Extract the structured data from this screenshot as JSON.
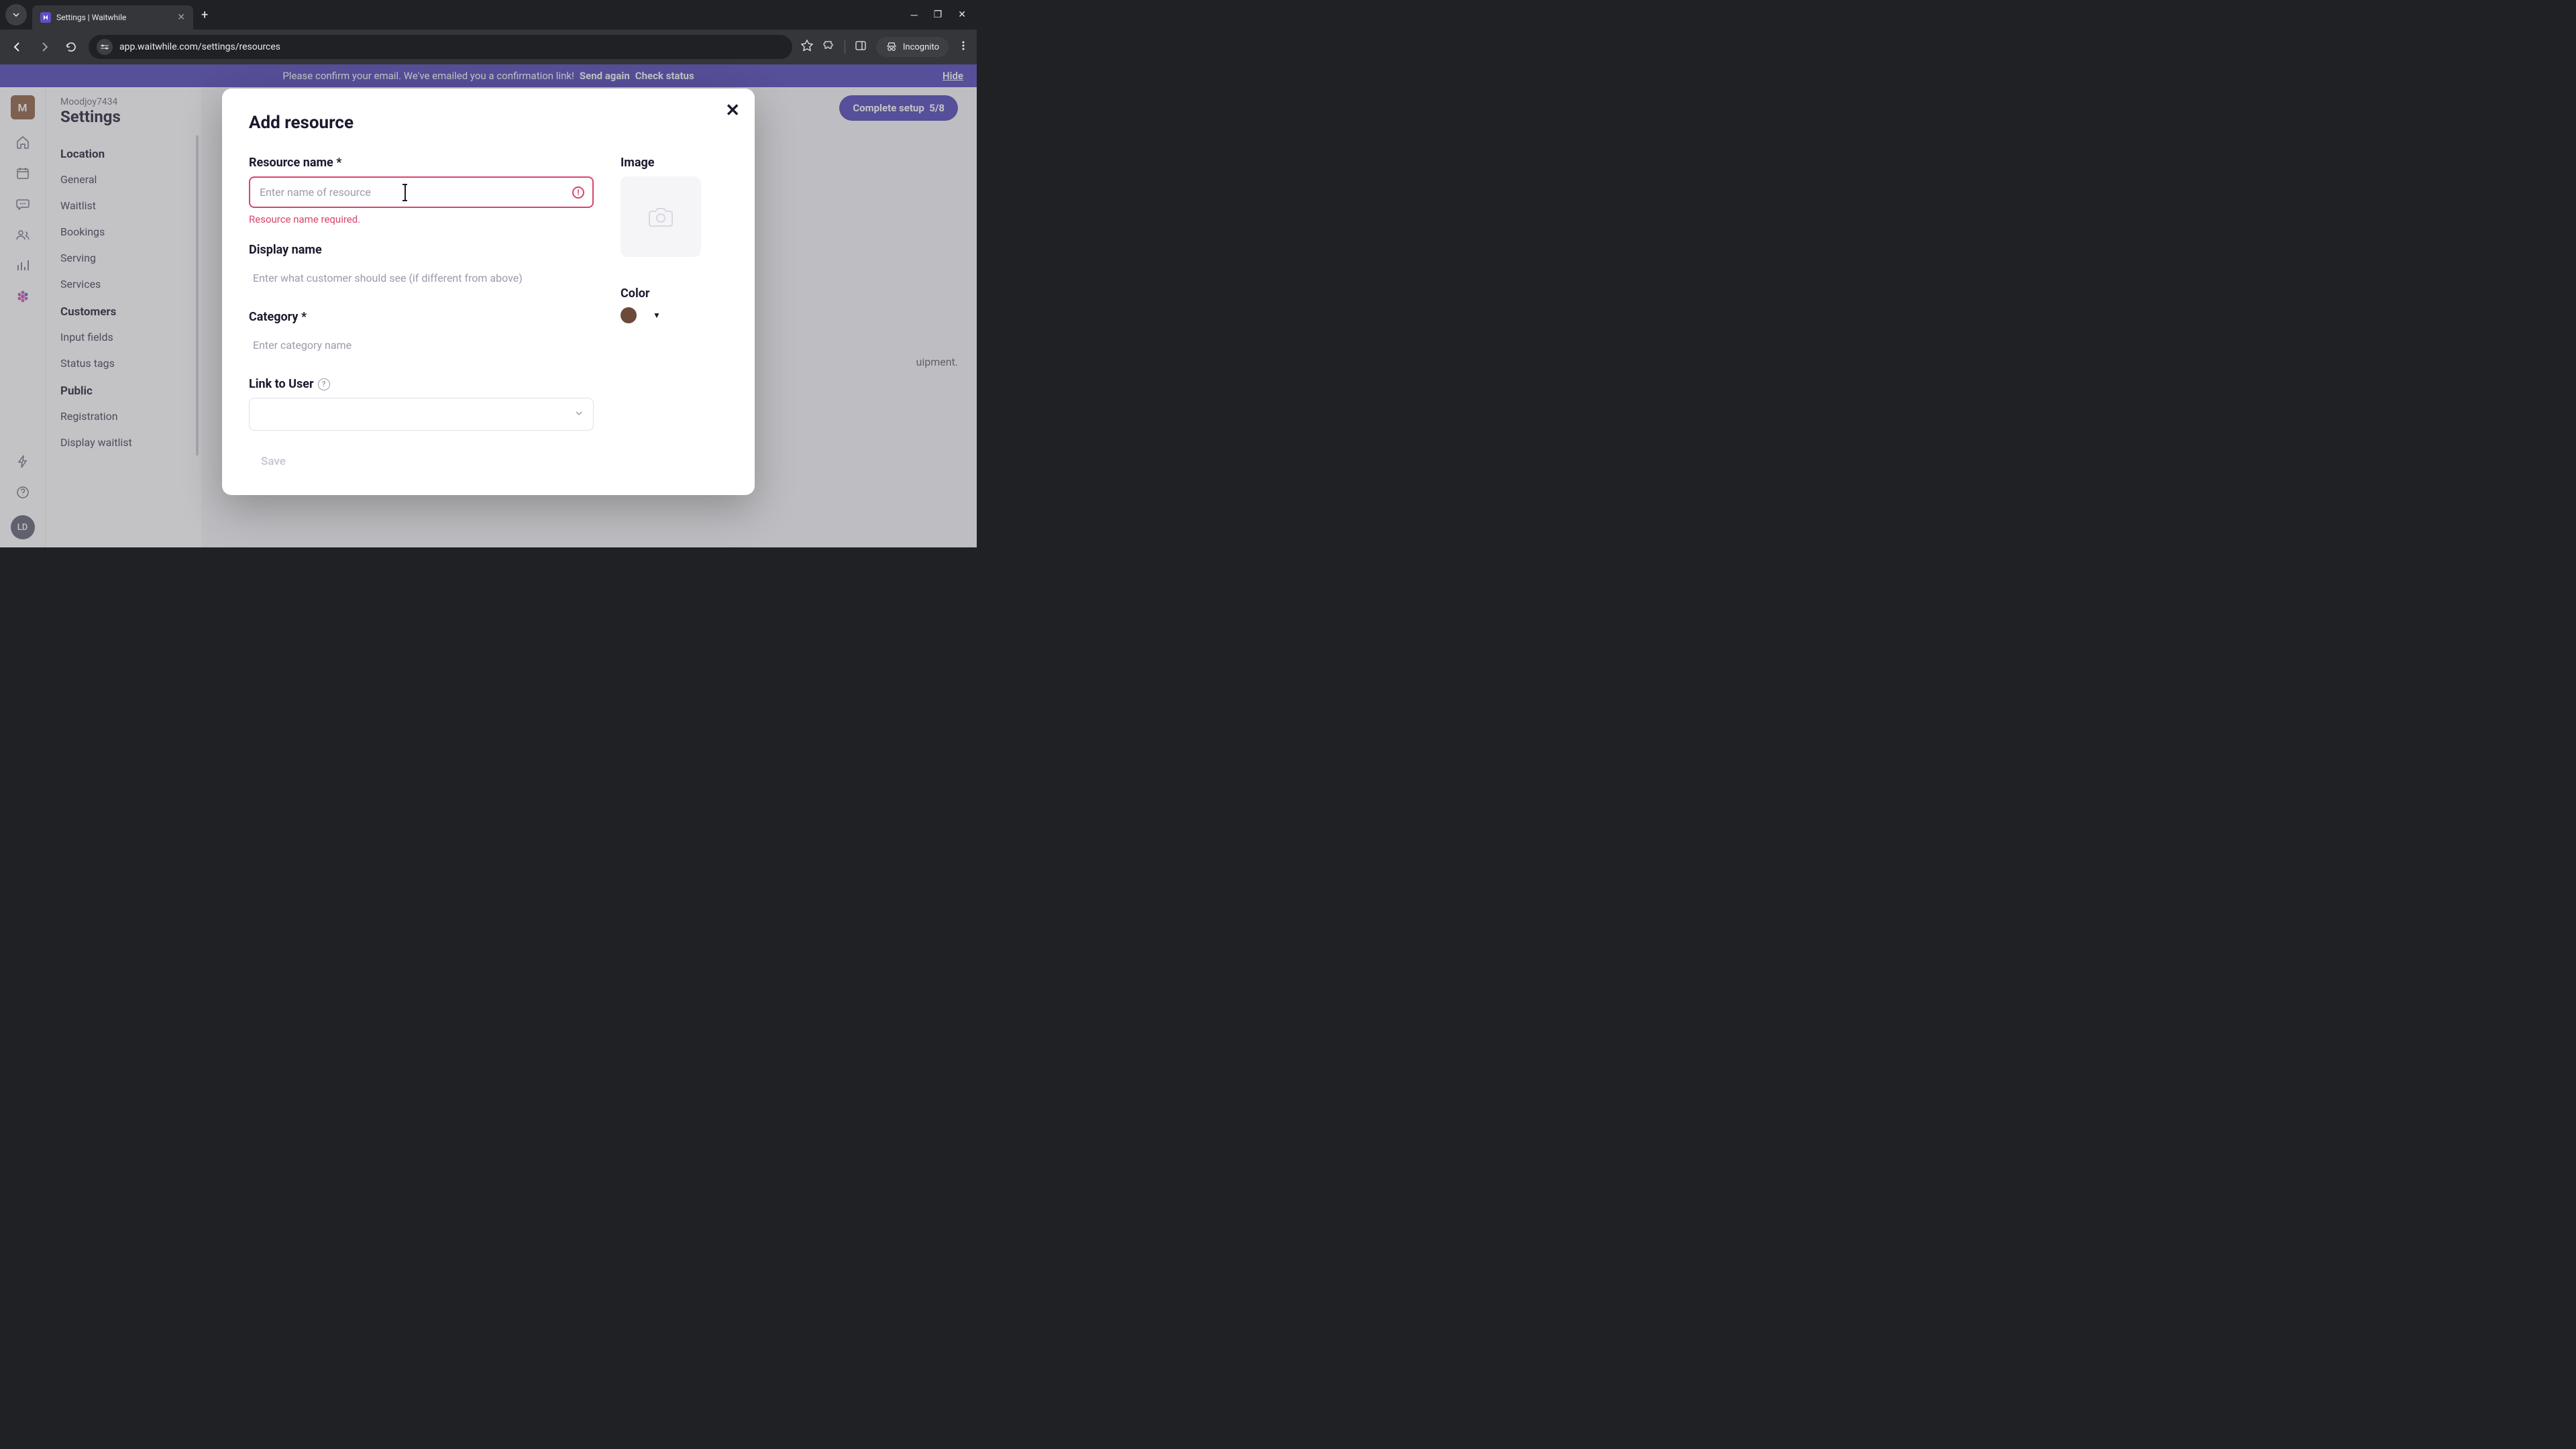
{
  "browser": {
    "tab_title": "Settings | Waitwhile",
    "url": "app.waitwhile.com/settings/resources",
    "incognito_label": "Incognito"
  },
  "banner": {
    "text_prefix": "Please confirm your email. We've emailed you a confirmation link!",
    "send_again": "Send again",
    "check_status": "Check status",
    "hide": "Hide"
  },
  "header": {
    "org": "Moodjoy7434",
    "page": "Settings",
    "avatar_letter": "M",
    "setup_label": "Complete setup",
    "setup_progress": "5/8",
    "bottom_avatar": "LD"
  },
  "sidebar": {
    "sections": [
      {
        "heading": "Location",
        "items": [
          "General",
          "Waitlist",
          "Bookings",
          "Serving",
          "Services"
        ]
      },
      {
        "heading": "Customers",
        "items": [
          "Input fields",
          "Status tags"
        ]
      },
      {
        "heading": "Public",
        "items": [
          "Registration",
          "Display waitlist"
        ]
      }
    ]
  },
  "main": {
    "hint_fragment": "uipment."
  },
  "modal": {
    "title": "Add resource",
    "fields": {
      "resource_name": {
        "label": "Resource name *",
        "placeholder": "Enter name of resource",
        "error": "Resource name required."
      },
      "display_name": {
        "label": "Display name",
        "placeholder": "Enter what customer should see (if different from above)"
      },
      "category": {
        "label": "Category *",
        "placeholder": "Enter category name"
      },
      "link_user": {
        "label": "Link to User"
      },
      "image": {
        "label": "Image"
      },
      "color": {
        "label": "Color",
        "value": "#6b4a3a"
      }
    },
    "save": "Save"
  }
}
